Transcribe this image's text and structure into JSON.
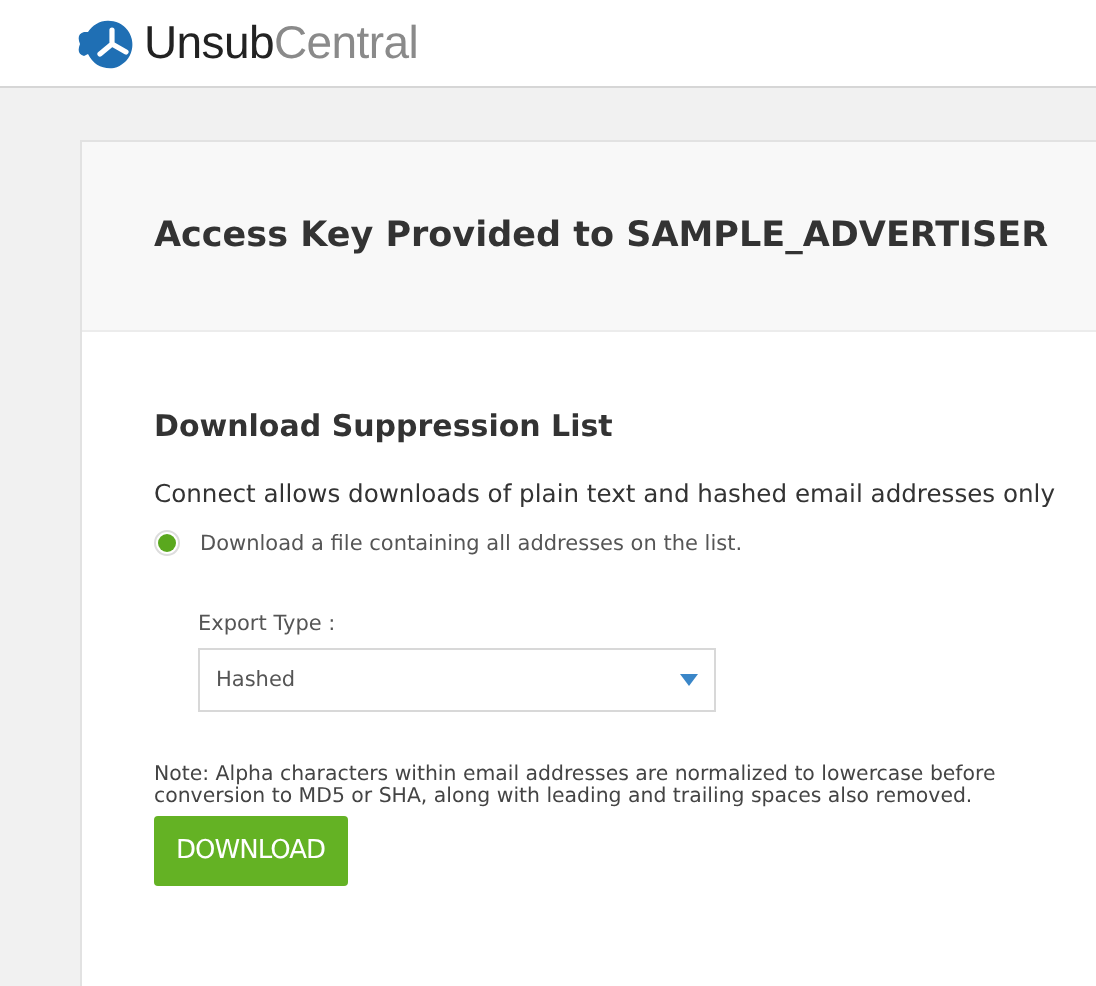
{
  "header": {
    "logo": {
      "first": "Unsub",
      "second": "Central"
    }
  },
  "card": {
    "title": "Access Key Provided to SAMPLE_ADVERTISER",
    "section_title": "Download Suppression List",
    "intro": "Connect allows downloads of plain text and hashed email addresses only",
    "options": [
      {
        "label": "Download a file containing all addresses on the list.",
        "selected": true
      }
    ],
    "export_type": {
      "label": "Export Type :",
      "value": "Hashed"
    },
    "note": "Note: Alpha characters within email addresses are normalized to lowercase before conversion to MD5 or SHA, along with leading and trailing spaces also removed.",
    "button": "DOWNLOAD"
  }
}
